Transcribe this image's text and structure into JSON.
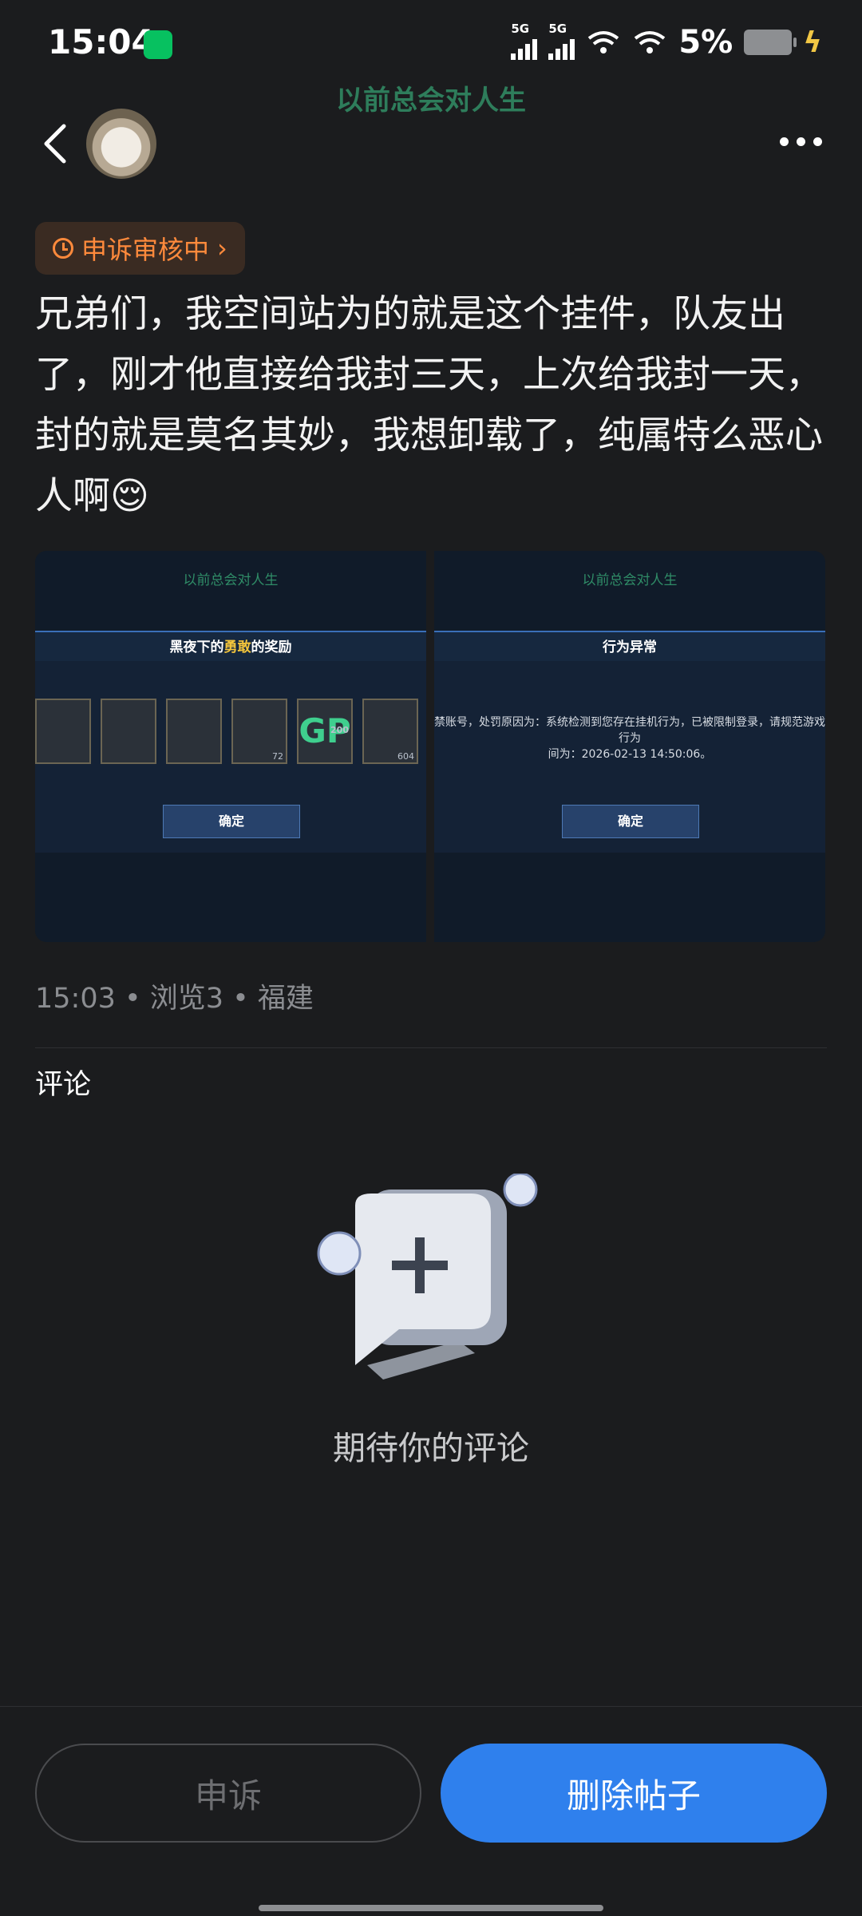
{
  "status_bar": {
    "time": "15:04",
    "net1": "5G",
    "net2": "5G",
    "battery": "5%"
  },
  "header": {
    "group_title": "以前总会对人生"
  },
  "post": {
    "status_badge": "申诉审核中",
    "body": "兄弟们，我空间站为的就是这个挂件，队友出了，刚才他直接给我封三天，上次给我封一天，封的就是莫名其妙，我想卸载了，纯属特么恶心人啊😌",
    "images": [
      {
        "header": "以前总会对人生",
        "band_title_parts": [
          "黑夜下的",
          "勇敢",
          "的奖励"
        ],
        "items": [
          "",
          "",
          "",
          "72",
          "GP",
          "200",
          "604"
        ],
        "button": "确定"
      },
      {
        "header": "以前总会对人生",
        "band_title": "行为异常",
        "message_line1": "禁账号，处罚原因为：系统检测到您存在挂机行为，已被限制登录，请规范游戏行为",
        "message_line2": "间为：2026-02-13 14:50:06。",
        "button": "确定"
      }
    ],
    "meta": "15:03 • 浏览3 • 福建"
  },
  "comments": {
    "heading": "评论",
    "empty_text": "期待你的评论"
  },
  "actions": {
    "appeal_label": "申诉",
    "delete_label": "删除帖子"
  },
  "colors": {
    "background": "#1b1c1e",
    "accent_blue": "#2f80ed",
    "badge_orange": "#ff8a3c",
    "group_green": "#2e7d5b"
  }
}
